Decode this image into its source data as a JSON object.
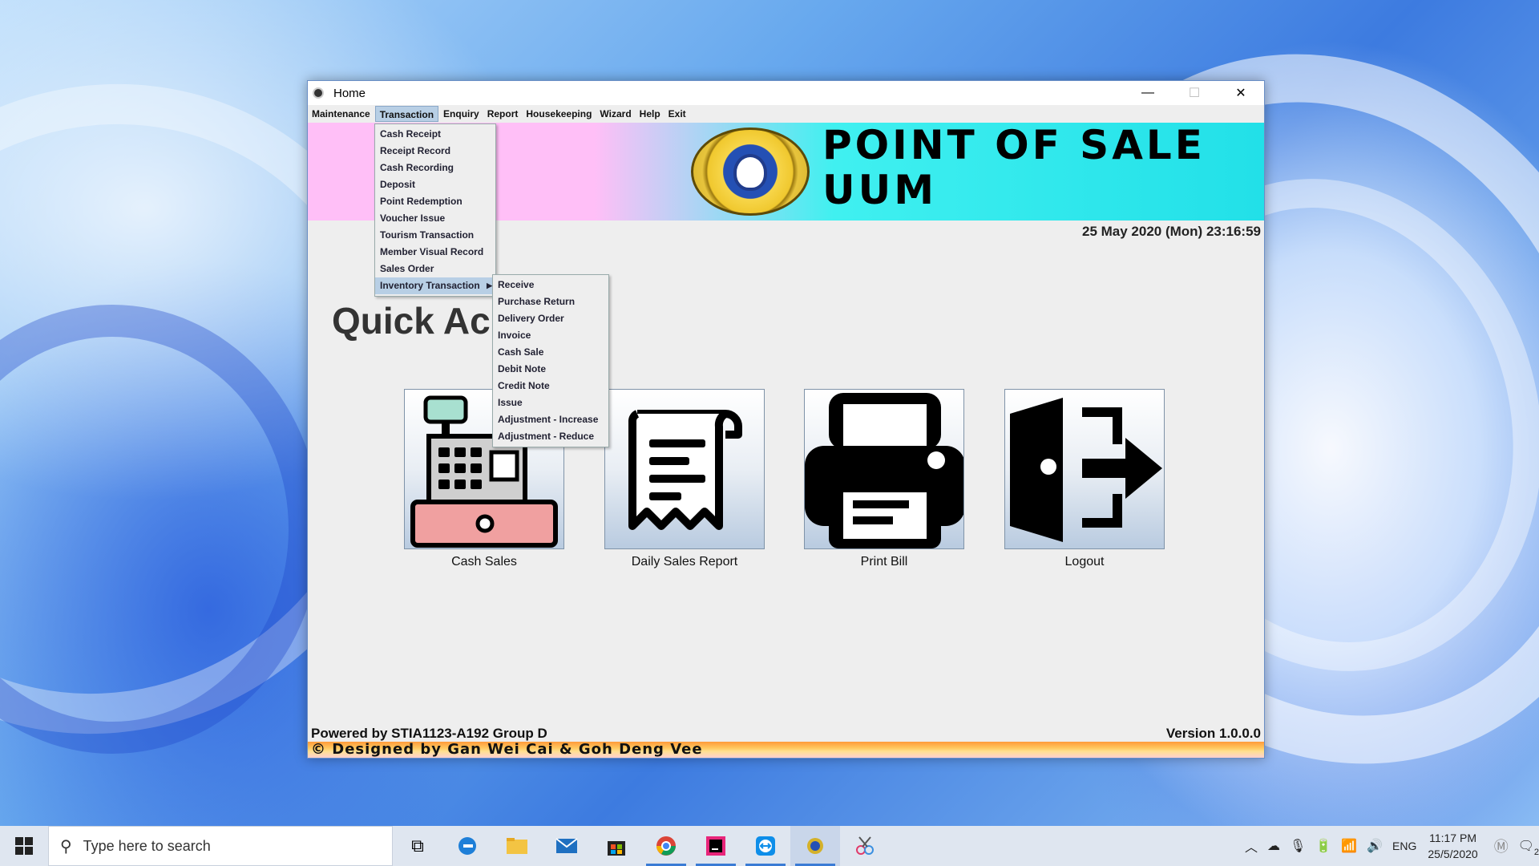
{
  "window": {
    "title": "Home",
    "controls": {
      "minimize": "—",
      "maximize": "☐",
      "close": "✕"
    }
  },
  "menubar": [
    "Maintenance",
    "Transaction",
    "Enquiry",
    "Report",
    "Housekeeping",
    "Wizard",
    "Help",
    "Exit"
  ],
  "transaction_menu": [
    "Cash Receipt",
    "Receipt Record",
    "Cash Recording",
    "Deposit",
    "Point Redemption",
    "Voucher Issue",
    "Tourism Transaction",
    "Member Visual Record",
    "Sales Order",
    "Inventory Transaction"
  ],
  "inventory_submenu": [
    "Receive",
    "Purchase Return",
    "Delivery Order",
    "Invoice",
    "Cash Sale",
    "Debit Note",
    "Credit Note",
    "Issue",
    "Adjustment - Increase",
    "Adjustment - Reduce"
  ],
  "banner": {
    "line1": "POINT OF SALE",
    "line2": "UUM"
  },
  "datetime": "25 May 2020 (Mon) 23:16:59",
  "quick_access_title": "Quick Ac",
  "tiles": [
    {
      "label": "Cash Sales",
      "icon": "cash-register-icon"
    },
    {
      "label": "Daily Sales Report",
      "icon": "receipt-icon"
    },
    {
      "label": "Print Bill",
      "icon": "printer-icon"
    },
    {
      "label": "Logout",
      "icon": "logout-door-icon"
    }
  ],
  "footer": {
    "powered_by": "Powered by STIA1123-A192 Group D",
    "version": "Version 1.0.0.0",
    "designed_by": "© Designed by Gan Wei Cai & Goh Deng Vee"
  },
  "taskbar": {
    "search_placeholder": "Type here to search",
    "language": "ENG",
    "time": "11:17 PM",
    "date": "25/5/2020",
    "notification_count": "2"
  },
  "colors": {
    "banner_left": "#ffbff7",
    "banner_right": "#22e0e8",
    "menu_highlight": "#b8cfe5",
    "register_body": "#f0a0a0"
  }
}
